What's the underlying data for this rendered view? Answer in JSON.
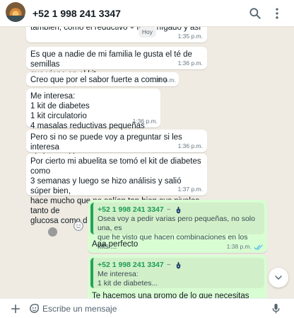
{
  "header": {
    "contact_name": "+52 1 998 241 3347"
  },
  "messages": [
    {
      "text": "también, como el reductivo + la de hígado y así",
      "time": "1:35 p.m.",
      "reply_tag": "Hoy"
    },
    {
      "text": "Es que a nadie de mi familia le gusta el té de semillas\nque viene en el kit",
      "time": "1:36 p.m."
    },
    {
      "text": "Creo que por el sabor fuerte a comino",
      "time": "1:36 p.m."
    },
    {
      "text": "Me interesa:\n1 kit de diabetes\n1 kit circulatorio\n4 masalas reductivas pequeñas",
      "time": "1:36 p.m."
    },
    {
      "text": "Pero si no se puede voy a preguntar si les interesa\nalgún otro kit",
      "time": "1:36 p.m."
    },
    {
      "text": "Por cierto mi abuelita se tomó el kit de diabetes como\n3 semanas y luego se hizo análisis y salió súper bien,\nhace mucho que no salían tan bien sus niveles tanto de\nglucosa como de colesterol y triglicéridos",
      "time": "1:37 p.m."
    }
  ],
  "outgoing": [
    {
      "quote_author": "+52 1 998 241 3347",
      "quote_suffix": "~",
      "quote_text": "Osea voy a pedir varias pero pequeñas, no solo una, es\nque he visto que hacen combinaciones en los kits ...",
      "text": "Aaa perfecto",
      "time": "1:38 p.m."
    },
    {
      "quote_author": "+52 1 998 241 3347",
      "quote_suffix": "~",
      "quote_text": "Me interesa:\n1 kit de diabetes...",
      "text": "Te hacemos una promo de lo que necesitas"
    }
  ],
  "composer": {
    "placeholder": "Escribe un mensaje"
  },
  "icons": {
    "search": "search-icon",
    "menu": "more-vert-icon",
    "attach": "plus-icon",
    "sticker": "sticker-icon",
    "mic": "mic-icon",
    "scroll_down": "chevron-down-icon",
    "read": "double-check-icon"
  },
  "colors": {
    "outgoing_bubble": "#d9fdd3",
    "quote_accent": "#25a35a",
    "read_ticks": "#53bdeb"
  }
}
